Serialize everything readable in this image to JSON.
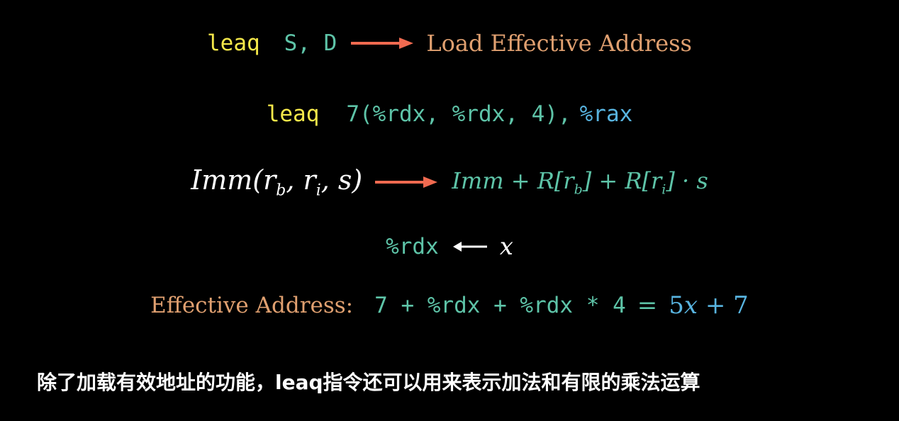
{
  "colors": {
    "background": "#000000",
    "yellow": "#f5e84a",
    "teal": "#5ec4a8",
    "blue": "#58b4e0",
    "orange": "#e0a070",
    "arrow_red": "#f06a50",
    "white": "#ffffff"
  },
  "line1": {
    "instruction": "leaq",
    "operands": "S, D",
    "description": "Load Effective Address"
  },
  "line2": {
    "instruction": "leaq",
    "source": "7(%rdx, %rdx, 4),",
    "dest": "%rax"
  },
  "line3": {
    "lhs": "Imm(r",
    "lhs_sub_b": "b",
    "lhs_mid": ", r",
    "lhs_sub_i": "i",
    "lhs_end": ", s)",
    "rhs_part1": "Imm + R[r",
    "rhs_sub_b": "b",
    "rhs_part2": "] + R[r",
    "rhs_sub_i": "i",
    "rhs_part3": "] · s"
  },
  "line4": {
    "register": "%rdx",
    "variable": "x"
  },
  "line5": {
    "label": "Effective Address:",
    "expression": "7 + %rdx + %rdx * 4",
    "equals": "=",
    "result_coef": "5",
    "result_var": "x",
    "result_rest": "+ 7"
  },
  "caption": "除了加载有效地址的功能，leaq指令还可以用来表示加法和有限的乘法运算"
}
